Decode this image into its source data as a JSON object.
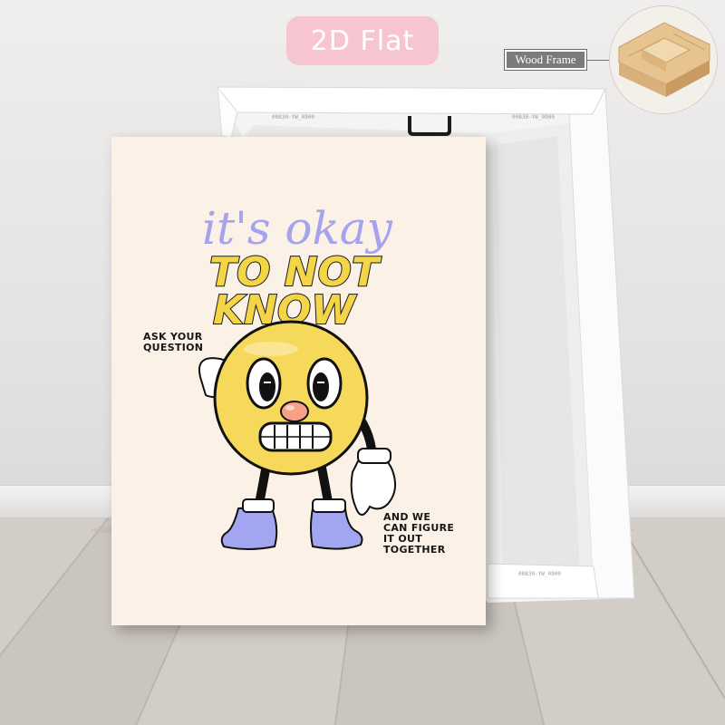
{
  "badge": {
    "label": "2D Flat",
    "color": "#f7c5d0"
  },
  "callout": {
    "label": "Wood Frame"
  },
  "canvas_back": {
    "print_codes": [
      "00830-YW_0900",
      "00830-YW_0900",
      "00830-YW_0900"
    ]
  },
  "poster": {
    "script_line": "it's okay",
    "headline_1": "TO NOT",
    "headline_2": "KNOW",
    "left_text": "ASK YOUR\nQUESTION",
    "right_text": "AND WE\nCAN FIGURE\nIT OUT\nTOGETHER",
    "colors": {
      "background": "#fbf1e6",
      "script": "#a5a3ee",
      "headline": "#f4d548",
      "face": "#f6d85a",
      "shoes": "#a2a6f0",
      "nose": "#f6a085"
    }
  },
  "icons": [
    "wood-frame-photo-icon",
    "hanging-hook-icon",
    "cartoon-smiley-character-icon"
  ]
}
